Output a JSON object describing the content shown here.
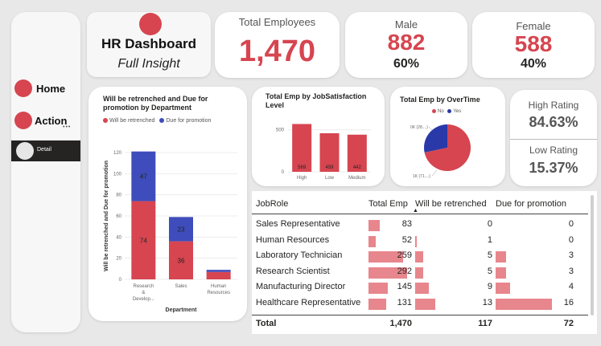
{
  "nav": {
    "home_label": "Home",
    "action_label": "Action",
    "detail_label": "Detail",
    "more_glyph": "•••"
  },
  "header": {
    "title": "HR Dashboard",
    "subtitle": "Full Insight"
  },
  "kpis": {
    "total_title": "Total Employees",
    "total_value": "1,470",
    "male_title": "Male",
    "male_value": "882",
    "male_pct": "60%",
    "female_title": "Female",
    "female_value": "588",
    "female_pct": "40%",
    "high_title": "High Rating",
    "high_value": "84.63%",
    "low_title": "Low Rating",
    "low_value": "15.37%"
  },
  "colors": {
    "red": "#d64550",
    "blue": "#3e4dbb",
    "dark_blue": "#2a39a8"
  },
  "chart_data": [
    {
      "type": "bar",
      "stacked": true,
      "title": "Will be retrenched and Due for promotion by Department",
      "xlabel": "Department",
      "ylabel": "Will be retrenched and Due for promotion",
      "categories": [
        "Research & Develop...",
        "Sales",
        "Human Resources"
      ],
      "series": [
        {
          "name": "Will be retrenched",
          "values": [
            74,
            36,
            7
          ]
        },
        {
          "name": "Due for promotion",
          "values": [
            47,
            23,
            2
          ]
        }
      ],
      "yticks": [
        "0",
        "20",
        "40",
        "60",
        "80",
        "100",
        "120"
      ],
      "ylim": [
        0,
        120
      ],
      "legend": "top-left"
    },
    {
      "type": "bar",
      "title": "Total Emp by JobSatisfaction Level",
      "categories": [
        "High",
        "Low",
        "Medium"
      ],
      "values": [
        569,
        459,
        442
      ],
      "yticks": [
        "0",
        "500"
      ],
      "ylim": [
        0,
        650
      ]
    },
    {
      "type": "pie",
      "title": "Total Emp by OverTime",
      "legend_labels": [
        "No",
        "Yes"
      ],
      "slices": [
        {
          "name": "No",
          "value": 1054,
          "label": "1K (71....)"
        },
        {
          "name": "Yes",
          "value": 416,
          "label": "0K (28....)"
        }
      ],
      "legend": "top"
    },
    {
      "type": "table",
      "columns": [
        "JobRole",
        "Total Emp",
        "Will be retrenched",
        "Due for promotion"
      ],
      "rows": [
        {
          "role": "Sales Representative",
          "total": 83,
          "retrench": 0,
          "promo": 0
        },
        {
          "role": "Human Resources",
          "total": 52,
          "retrench": 1,
          "promo": 0
        },
        {
          "role": "Laboratory Technician",
          "total": 259,
          "retrench": 5,
          "promo": 3
        },
        {
          "role": "Research Scientist",
          "total": 292,
          "retrench": 5,
          "promo": 3
        },
        {
          "role": "Manufacturing Director",
          "total": 145,
          "retrench": 9,
          "promo": 4
        },
        {
          "role": "Healthcare Representative",
          "total": 131,
          "retrench": 13,
          "promo": 16
        }
      ],
      "total_row": {
        "label": "Total",
        "total": "1,470",
        "retrench": "117",
        "promo": "72"
      }
    }
  ]
}
